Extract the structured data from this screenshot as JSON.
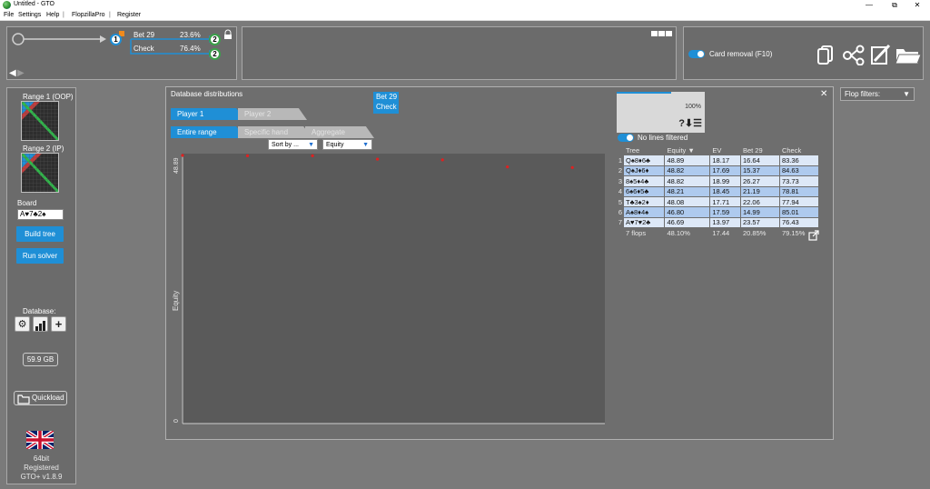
{
  "window": {
    "title": "Untitled - GTO",
    "minimize": "—",
    "maximize": "⧉",
    "close": "✕"
  },
  "menu": {
    "items": [
      "File",
      "Settings",
      "Help",
      "FlopzillaPro",
      "Register"
    ]
  },
  "tree": {
    "node_num": "1",
    "bet_label": "Bet 29",
    "bet_pct": "23.6%",
    "check_label": "Check",
    "check_pct": "76.4%",
    "child_num": "2",
    "orange_badge": "2"
  },
  "top_right": {
    "card_removal": "Card removal (F10)"
  },
  "left": {
    "range1": "Range 1 (OOP)",
    "range2": "Range 2 (IP)",
    "board_label": "Board",
    "board_value": "A♥7♣2♠",
    "build_tree": "Build tree",
    "run_solver": "Run solver",
    "database_label": "Database:",
    "db_size": "59.9 GB",
    "quickload": "Quickload",
    "bits": "64bit",
    "registered": "Registered",
    "version": "GTO+ v1.8.9"
  },
  "dialog": {
    "title": "Database distributions",
    "close": "✕",
    "tabs_player": [
      "Player 1",
      "Player 2"
    ],
    "tabs_range": [
      "Entire range",
      "Specific hand",
      "Aggregate"
    ],
    "sort_by": "Sort by ...",
    "metric": "Equity",
    "action_line1": "Bet 29",
    "action_line2": "Check",
    "preview_pct": "100%",
    "preview_icons": "?⬇☰",
    "no_lines": "No lines filtered",
    "flop_filters": "Flop filters:"
  },
  "table": {
    "headers": [
      "Tree",
      "Equity ▼",
      "EV",
      "Bet 29",
      "Check"
    ],
    "rows": [
      {
        "idx": "1",
        "flop": "Q♠8♦6♣",
        "equity": "48.89",
        "ev": "18.17",
        "bet": "16.64",
        "check": "83.36"
      },
      {
        "idx": "2",
        "flop": "Q♠J♦6♦",
        "equity": "48.82",
        "ev": "17.69",
        "bet": "15.37",
        "check": "84.63"
      },
      {
        "idx": "3",
        "flop": "8♠5♦4♣",
        "equity": "48.82",
        "ev": "18.99",
        "bet": "26.27",
        "check": "73.73"
      },
      {
        "idx": "4",
        "flop": "6♠6♦5♣",
        "equity": "48.21",
        "ev": "18.45",
        "bet": "21.19",
        "check": "78.81"
      },
      {
        "idx": "5",
        "flop": "T♣3♠2♦",
        "equity": "48.08",
        "ev": "17.71",
        "bet": "22.06",
        "check": "77.94"
      },
      {
        "idx": "6",
        "flop": "A♠8♦4♠",
        "equity": "46.80",
        "ev": "17.59",
        "bet": "14.99",
        "check": "85.01"
      },
      {
        "idx": "7",
        "flop": "A♥7♥2♣",
        "equity": "46.69",
        "ev": "13.97",
        "bet": "23.57",
        "check": "76.43"
      }
    ],
    "footer": {
      "flops": "7 flops",
      "equity": "48.10%",
      "ev": "17.44",
      "bet": "20.85%",
      "check": "79.15%"
    }
  },
  "chart_data": {
    "type": "scatter",
    "title": "",
    "xlabel": "",
    "ylabel": "Equity",
    "y_tick_labels": [
      "48.89",
      "0"
    ],
    "ylim": [
      0,
      48.89
    ],
    "points": [
      {
        "x": 1,
        "y": 48.89
      },
      {
        "x": 2,
        "y": 48.82
      },
      {
        "x": 3,
        "y": 48.82
      },
      {
        "x": 4,
        "y": 48.21
      },
      {
        "x": 5,
        "y": 48.08
      },
      {
        "x": 6,
        "y": 46.8
      },
      {
        "x": 7,
        "y": 46.69
      }
    ],
    "point_color": "#e02020",
    "grid": false
  },
  "colors": {
    "accent": "#1f8fd6",
    "panel": "#6b6b6b",
    "background": "#7a7a7a",
    "chart_bg": "#5a5a5a"
  }
}
